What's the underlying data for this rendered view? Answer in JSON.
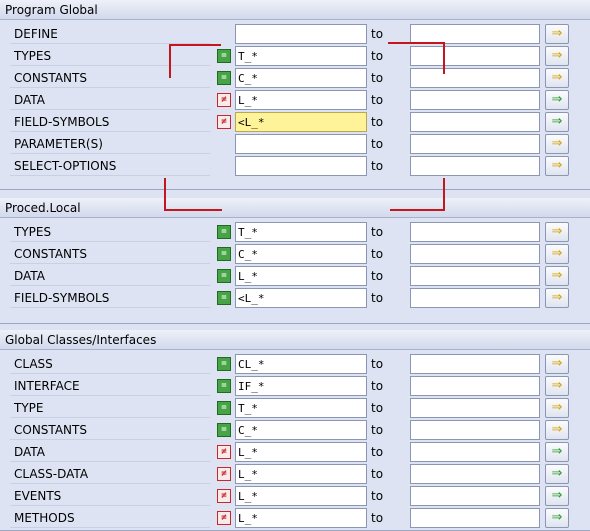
{
  "to_label": "to",
  "groups": [
    {
      "title": "Program Global",
      "rows": [
        {
          "label": "DEFINE",
          "icon": null,
          "low": "",
          "btn": "more"
        },
        {
          "label": "TYPES",
          "icon": "include",
          "low": "T_*",
          "btn": "more"
        },
        {
          "label": "CONSTANTS",
          "icon": "include",
          "low": "C_*",
          "btn": "more"
        },
        {
          "label": "DATA",
          "icon": "exclude",
          "low": "L_*",
          "btn": "more-active"
        },
        {
          "label": "FIELD-SYMBOLS",
          "icon": "exclude",
          "low": "<L_*",
          "btn": "more-active",
          "focused": true
        },
        {
          "label": "PARAMETER(S)",
          "icon": null,
          "low": "",
          "btn": "more"
        },
        {
          "label": "SELECT-OPTIONS",
          "icon": null,
          "low": "",
          "btn": "more"
        }
      ]
    },
    {
      "title": "Proced.Local",
      "rows": [
        {
          "label": "TYPES",
          "icon": "include",
          "low": "T_*",
          "btn": "more"
        },
        {
          "label": "CONSTANTS",
          "icon": "include",
          "low": "C_*",
          "btn": "more"
        },
        {
          "label": "DATA",
          "icon": "include",
          "low": "L_*",
          "btn": "more"
        },
        {
          "label": "FIELD-SYMBOLS",
          "icon": "include",
          "low": "<L_*",
          "btn": "more"
        }
      ]
    },
    {
      "title": "Global Classes/Interfaces",
      "rows": [
        {
          "label": "CLASS",
          "icon": "include",
          "low": "CL_*",
          "btn": "more"
        },
        {
          "label": "INTERFACE",
          "icon": "include",
          "low": "IF_*",
          "btn": "more"
        },
        {
          "label": "TYPE",
          "icon": "include",
          "low": "T_*",
          "btn": "more"
        },
        {
          "label": "CONSTANTS",
          "icon": "include",
          "low": "C_*",
          "btn": "more"
        },
        {
          "label": "DATA",
          "icon": "exclude",
          "low": "L_*",
          "btn": "more-active"
        },
        {
          "label": "CLASS-DATA",
          "icon": "exclude",
          "low": "L_*",
          "btn": "more-active"
        },
        {
          "label": "EVENTS",
          "icon": "exclude",
          "low": "L_*",
          "btn": "more-active"
        },
        {
          "label": "METHODS",
          "icon": "exclude",
          "low": "L_*",
          "btn": "more-active"
        }
      ]
    }
  ],
  "colors": {
    "include": "#46a446",
    "exclude": "#c42a2a",
    "focus": "#fff39a",
    "annotation": "#c4161c"
  }
}
